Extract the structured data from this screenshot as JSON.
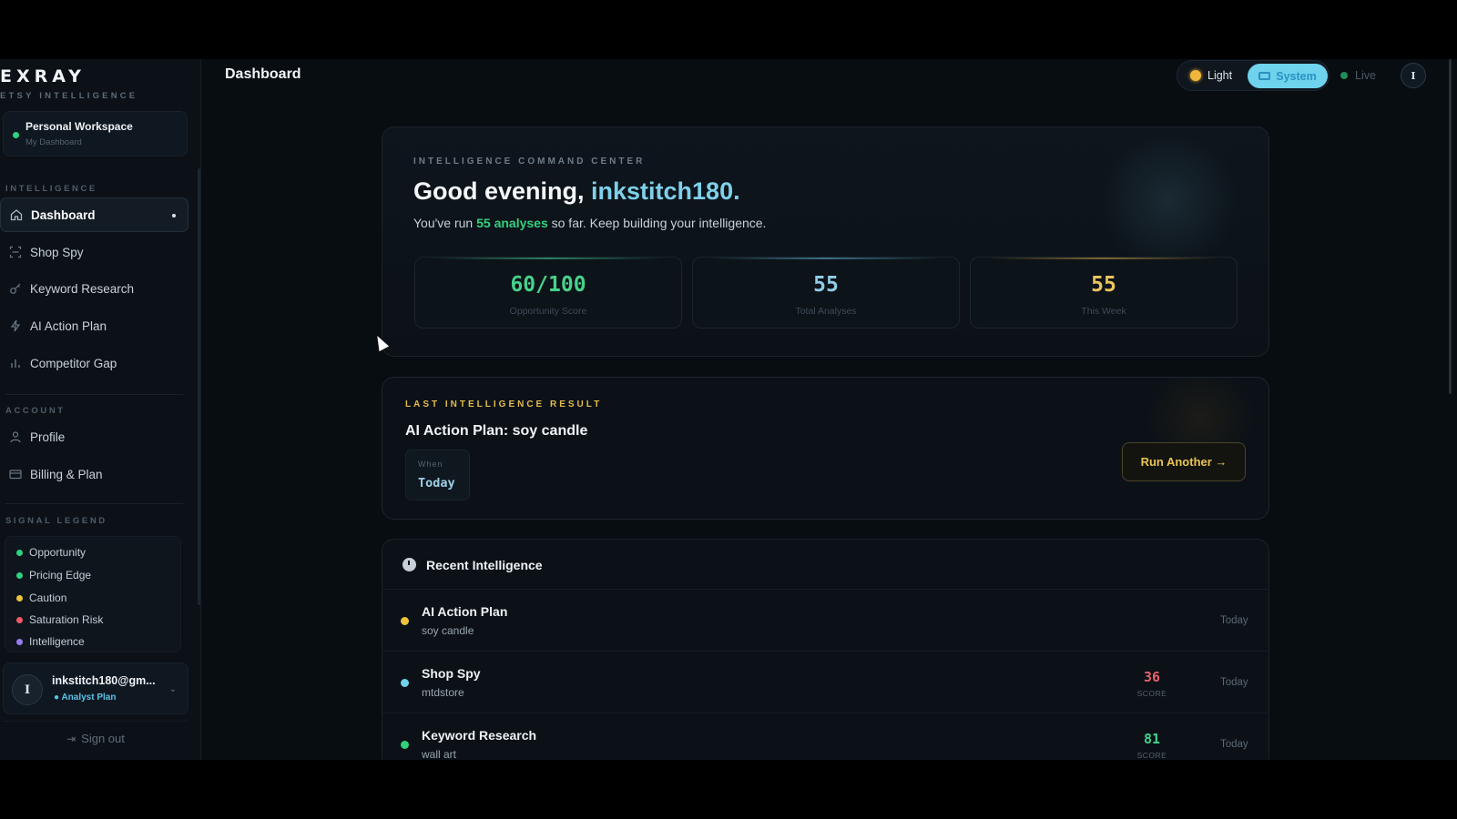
{
  "brand": {
    "name": "EXRAY",
    "tagline": "ETSY INTELLIGENCE"
  },
  "workspace": {
    "title": "Personal Workspace",
    "subtitle": "My Dashboard"
  },
  "sidebar": {
    "intelligence_label": "INTELLIGENCE",
    "intelligence_items": [
      {
        "label": "Dashboard",
        "icon": "home-icon",
        "active": true
      },
      {
        "label": "Shop Spy",
        "icon": "scan-icon"
      },
      {
        "label": "Keyword Research",
        "icon": "key-icon"
      },
      {
        "label": "AI Action Plan",
        "icon": "bolt-icon"
      },
      {
        "label": "Competitor Gap",
        "icon": "bar-chart-icon"
      }
    ],
    "account_label": "ACCOUNT",
    "account_items": [
      {
        "label": "Profile",
        "icon": "user-icon"
      },
      {
        "label": "Billing & Plan",
        "icon": "card-icon"
      }
    ],
    "legend_label": "SIGNAL LEGEND",
    "legend": [
      {
        "label": "Opportunity",
        "color": "#2fd27d"
      },
      {
        "label": "Pricing Edge",
        "color": "#2fd27d"
      },
      {
        "label": "Caution",
        "color": "#f0c23c"
      },
      {
        "label": "Saturation Risk",
        "color": "#ef5a64"
      },
      {
        "label": "Intelligence",
        "color": "#9a7cf0"
      }
    ],
    "user": {
      "initial": "I",
      "email": "inkstitch180@gm...",
      "plan": "● Analyst Plan"
    },
    "signout": "Sign out"
  },
  "header": {
    "title": "Dashboard",
    "theme": {
      "light": "Light",
      "system": "System",
      "selected": "System"
    },
    "live": "Live",
    "avatar_initial": "I"
  },
  "command_center": {
    "eyebrow": "INTELLIGENCE COMMAND CENTER",
    "greeting": "Good evening, ",
    "username": "inkstitch180.",
    "sub_prefix": "You've run ",
    "sub_highlight": "55 analyses",
    "sub_suffix": " so far. Keep building your intelligence.",
    "stats": [
      {
        "value": "60/100",
        "label": "Opportunity Score",
        "color": "#47d18a"
      },
      {
        "value": "55",
        "label": "Total Analyses",
        "color": "#8fcce4"
      },
      {
        "value": "55",
        "label": "This Week",
        "color": "#ecc45e"
      }
    ]
  },
  "last_result": {
    "eyebrow": "LAST INTELLIGENCE RESULT",
    "title": "AI Action Plan: soy candle",
    "when_label": "When",
    "when_value": "Today",
    "button": "Run Another →"
  },
  "recent": {
    "title": "Recent Intelligence",
    "score_label": "SCORE",
    "rows": [
      {
        "name": "AI Action Plan",
        "sub": "soy candle",
        "score": "",
        "when": "Today",
        "dot": "#f0c23c",
        "score_color": ""
      },
      {
        "name": "Shop Spy",
        "sub": "mtdstore",
        "score": "36",
        "when": "Today",
        "dot": "#6fd3ee",
        "score_color": "#e5606a"
      },
      {
        "name": "Keyword Research",
        "sub": "wall art",
        "score": "81",
        "when": "Today",
        "dot": "#2fd27d",
        "score_color": "#47d18a"
      }
    ]
  }
}
